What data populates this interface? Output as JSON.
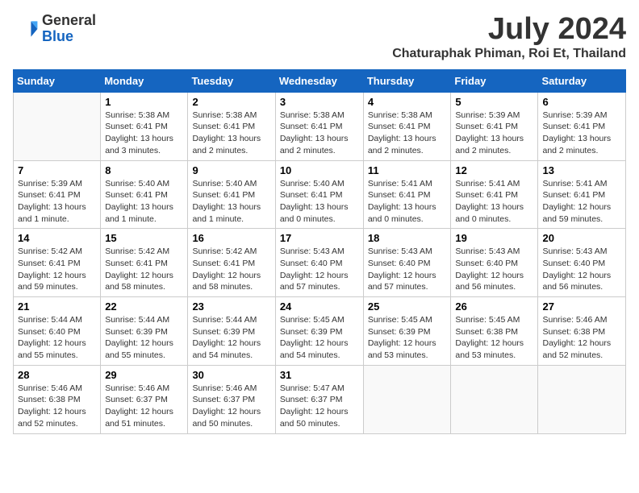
{
  "logo": {
    "general": "General",
    "blue": "Blue"
  },
  "header": {
    "month": "July 2024",
    "location": "Chaturaphak Phiman, Roi Et, Thailand"
  },
  "weekdays": [
    "Sunday",
    "Monday",
    "Tuesday",
    "Wednesday",
    "Thursday",
    "Friday",
    "Saturday"
  ],
  "weeks": [
    [
      {
        "day": "",
        "sunrise": "",
        "sunset": "",
        "daylight": ""
      },
      {
        "day": "1",
        "sunrise": "Sunrise: 5:38 AM",
        "sunset": "Sunset: 6:41 PM",
        "daylight": "Daylight: 13 hours and 3 minutes."
      },
      {
        "day": "2",
        "sunrise": "Sunrise: 5:38 AM",
        "sunset": "Sunset: 6:41 PM",
        "daylight": "Daylight: 13 hours and 2 minutes."
      },
      {
        "day": "3",
        "sunrise": "Sunrise: 5:38 AM",
        "sunset": "Sunset: 6:41 PM",
        "daylight": "Daylight: 13 hours and 2 minutes."
      },
      {
        "day": "4",
        "sunrise": "Sunrise: 5:38 AM",
        "sunset": "Sunset: 6:41 PM",
        "daylight": "Daylight: 13 hours and 2 minutes."
      },
      {
        "day": "5",
        "sunrise": "Sunrise: 5:39 AM",
        "sunset": "Sunset: 6:41 PM",
        "daylight": "Daylight: 13 hours and 2 minutes."
      },
      {
        "day": "6",
        "sunrise": "Sunrise: 5:39 AM",
        "sunset": "Sunset: 6:41 PM",
        "daylight": "Daylight: 13 hours and 2 minutes."
      }
    ],
    [
      {
        "day": "7",
        "sunrise": "Sunrise: 5:39 AM",
        "sunset": "Sunset: 6:41 PM",
        "daylight": "Daylight: 13 hours and 1 minute."
      },
      {
        "day": "8",
        "sunrise": "Sunrise: 5:40 AM",
        "sunset": "Sunset: 6:41 PM",
        "daylight": "Daylight: 13 hours and 1 minute."
      },
      {
        "day": "9",
        "sunrise": "Sunrise: 5:40 AM",
        "sunset": "Sunset: 6:41 PM",
        "daylight": "Daylight: 13 hours and 1 minute."
      },
      {
        "day": "10",
        "sunrise": "Sunrise: 5:40 AM",
        "sunset": "Sunset: 6:41 PM",
        "daylight": "Daylight: 13 hours and 0 minutes."
      },
      {
        "day": "11",
        "sunrise": "Sunrise: 5:41 AM",
        "sunset": "Sunset: 6:41 PM",
        "daylight": "Daylight: 13 hours and 0 minutes."
      },
      {
        "day": "12",
        "sunrise": "Sunrise: 5:41 AM",
        "sunset": "Sunset: 6:41 PM",
        "daylight": "Daylight: 13 hours and 0 minutes."
      },
      {
        "day": "13",
        "sunrise": "Sunrise: 5:41 AM",
        "sunset": "Sunset: 6:41 PM",
        "daylight": "Daylight: 12 hours and 59 minutes."
      }
    ],
    [
      {
        "day": "14",
        "sunrise": "Sunrise: 5:42 AM",
        "sunset": "Sunset: 6:41 PM",
        "daylight": "Daylight: 12 hours and 59 minutes."
      },
      {
        "day": "15",
        "sunrise": "Sunrise: 5:42 AM",
        "sunset": "Sunset: 6:41 PM",
        "daylight": "Daylight: 12 hours and 58 minutes."
      },
      {
        "day": "16",
        "sunrise": "Sunrise: 5:42 AM",
        "sunset": "Sunset: 6:41 PM",
        "daylight": "Daylight: 12 hours and 58 minutes."
      },
      {
        "day": "17",
        "sunrise": "Sunrise: 5:43 AM",
        "sunset": "Sunset: 6:40 PM",
        "daylight": "Daylight: 12 hours and 57 minutes."
      },
      {
        "day": "18",
        "sunrise": "Sunrise: 5:43 AM",
        "sunset": "Sunset: 6:40 PM",
        "daylight": "Daylight: 12 hours and 57 minutes."
      },
      {
        "day": "19",
        "sunrise": "Sunrise: 5:43 AM",
        "sunset": "Sunset: 6:40 PM",
        "daylight": "Daylight: 12 hours and 56 minutes."
      },
      {
        "day": "20",
        "sunrise": "Sunrise: 5:43 AM",
        "sunset": "Sunset: 6:40 PM",
        "daylight": "Daylight: 12 hours and 56 minutes."
      }
    ],
    [
      {
        "day": "21",
        "sunrise": "Sunrise: 5:44 AM",
        "sunset": "Sunset: 6:40 PM",
        "daylight": "Daylight: 12 hours and 55 minutes."
      },
      {
        "day": "22",
        "sunrise": "Sunrise: 5:44 AM",
        "sunset": "Sunset: 6:39 PM",
        "daylight": "Daylight: 12 hours and 55 minutes."
      },
      {
        "day": "23",
        "sunrise": "Sunrise: 5:44 AM",
        "sunset": "Sunset: 6:39 PM",
        "daylight": "Daylight: 12 hours and 54 minutes."
      },
      {
        "day": "24",
        "sunrise": "Sunrise: 5:45 AM",
        "sunset": "Sunset: 6:39 PM",
        "daylight": "Daylight: 12 hours and 54 minutes."
      },
      {
        "day": "25",
        "sunrise": "Sunrise: 5:45 AM",
        "sunset": "Sunset: 6:39 PM",
        "daylight": "Daylight: 12 hours and 53 minutes."
      },
      {
        "day": "26",
        "sunrise": "Sunrise: 5:45 AM",
        "sunset": "Sunset: 6:38 PM",
        "daylight": "Daylight: 12 hours and 53 minutes."
      },
      {
        "day": "27",
        "sunrise": "Sunrise: 5:46 AM",
        "sunset": "Sunset: 6:38 PM",
        "daylight": "Daylight: 12 hours and 52 minutes."
      }
    ],
    [
      {
        "day": "28",
        "sunrise": "Sunrise: 5:46 AM",
        "sunset": "Sunset: 6:38 PM",
        "daylight": "Daylight: 12 hours and 52 minutes."
      },
      {
        "day": "29",
        "sunrise": "Sunrise: 5:46 AM",
        "sunset": "Sunset: 6:37 PM",
        "daylight": "Daylight: 12 hours and 51 minutes."
      },
      {
        "day": "30",
        "sunrise": "Sunrise: 5:46 AM",
        "sunset": "Sunset: 6:37 PM",
        "daylight": "Daylight: 12 hours and 50 minutes."
      },
      {
        "day": "31",
        "sunrise": "Sunrise: 5:47 AM",
        "sunset": "Sunset: 6:37 PM",
        "daylight": "Daylight: 12 hours and 50 minutes."
      },
      {
        "day": "",
        "sunrise": "",
        "sunset": "",
        "daylight": ""
      },
      {
        "day": "",
        "sunrise": "",
        "sunset": "",
        "daylight": ""
      },
      {
        "day": "",
        "sunrise": "",
        "sunset": "",
        "daylight": ""
      }
    ]
  ]
}
